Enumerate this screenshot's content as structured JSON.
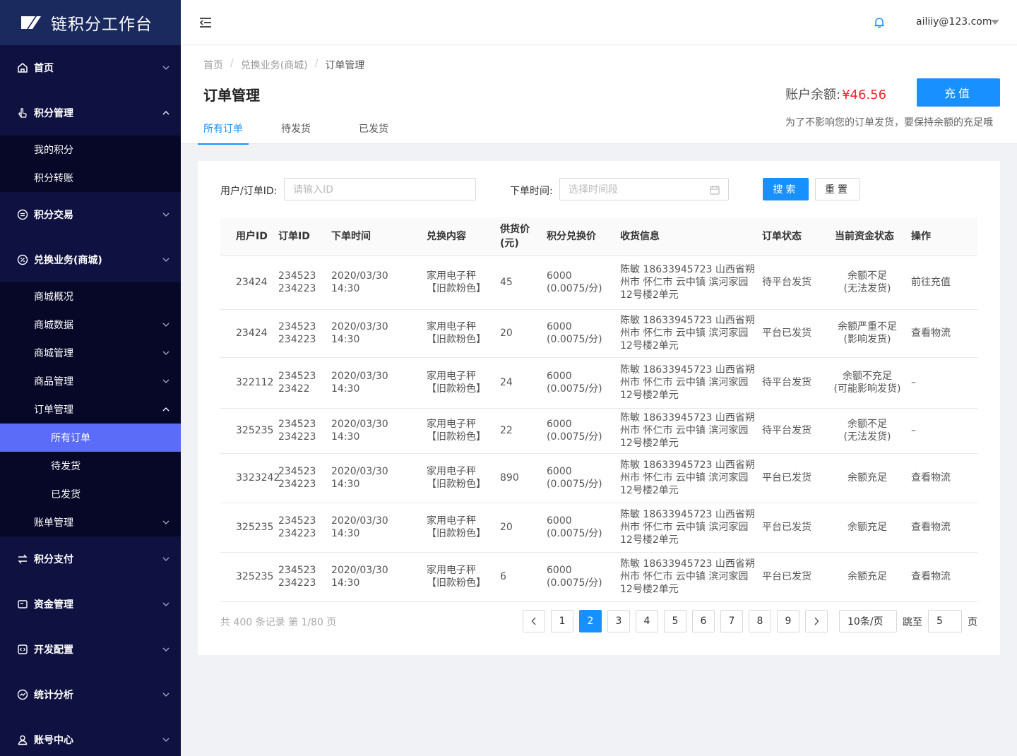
{
  "brand": {
    "name": "链积分工作台"
  },
  "sidebar": {
    "top": [
      {
        "label": "首页",
        "icon": "home-icon"
      },
      {
        "label": "积分管理",
        "icon": "hand-point-icon"
      },
      {
        "label": "积分交易",
        "icon": "exchange-circle-icon"
      },
      {
        "label": "兑换业务(商城)",
        "icon": "percent-circle-icon"
      },
      {
        "label": "积分支付",
        "icon": "transfer-icon"
      },
      {
        "label": "资金管理",
        "icon": "wallet-icon"
      },
      {
        "label": "开发配置",
        "icon": "code-icon"
      },
      {
        "label": "统计分析",
        "icon": "trend-icon"
      },
      {
        "label": "账号中心",
        "icon": "user-icon"
      }
    ],
    "points_sub": [
      "我的积分",
      "积分转账"
    ],
    "mall_sub": [
      "商城概况",
      "商城数据",
      "商城管理",
      "商品管理",
      "订单管理",
      "账单管理"
    ],
    "order_sub": [
      "所有订单",
      "待发货",
      "已发货"
    ]
  },
  "header": {
    "user_email": "ailiiy@123.com"
  },
  "breadcrumb": [
    "首页",
    "兑换业务(商城)",
    "订单管理"
  ],
  "page": {
    "title": "订单管理",
    "balance_label": "账户余额:",
    "balance_value": "¥46.56",
    "recharge_label": "充值",
    "hint": "为了不影响您的订单发货，要保持余额的充足哦"
  },
  "tabs": [
    "所有订单",
    "待发货",
    "已发货"
  ],
  "filters": {
    "id_label": "用户/订单ID:",
    "id_placeholder": "请输入ID",
    "time_label": "下单时间:",
    "time_placeholder": "选择时间段",
    "search_label": "搜索",
    "reset_label": "重置"
  },
  "table": {
    "headers": [
      "用户ID",
      "订单ID",
      "下单时间",
      "兑换内容",
      "供货价(元)",
      "积分兑换价",
      "收货信息",
      "订单状态",
      "当前资金状态",
      "操作"
    ],
    "rows": [
      {
        "user_id": "23424",
        "order_id_1": "234523",
        "order_id_2": "234223",
        "time": "2020/03/30 14:30",
        "item_1": "家用电子秤",
        "item_2": "【旧款粉色】",
        "supply": "45",
        "points_1": "6000",
        "points_2": "(0.0075/分)",
        "addr": "陈敏 18633945723 山西省朔州市 怀仁市 云中镇 滨河家园12号楼2单元",
        "status": "待平台发货",
        "status_color": "red",
        "fund_1": "余额不足",
        "fund_2": "(无法发货)",
        "fund_color": "red",
        "op": "前往充值",
        "op_link": true
      },
      {
        "user_id": "23424",
        "order_id_1": "234523",
        "order_id_2": "234223",
        "time": "2020/03/30 14:30",
        "item_1": "家用电子秤",
        "item_2": "【旧款粉色】",
        "supply": "20",
        "points_1": "6000",
        "points_2": "(0.0075/分)",
        "addr": "陈敏 18633945723 山西省朔州市 怀仁市 云中镇 滨河家园12号楼2单元",
        "status": "平台已发货",
        "status_color": "normal",
        "fund_1": "余额严重不足",
        "fund_2": "(影响发货)",
        "fund_color": "orange",
        "op": "查看物流",
        "op_link": true
      },
      {
        "user_id": "322112",
        "order_id_1": "234523",
        "order_id_2": "23422",
        "time": "2020/03/30 14:30",
        "item_1": "家用电子秤",
        "item_2": "【旧款粉色】",
        "supply": "24",
        "points_1": "6000",
        "points_2": "(0.0075/分)",
        "addr": "陈敏 18633945723 山西省朔州市 怀仁市 云中镇 滨河家园12号楼2单元",
        "status": "待平台发货",
        "status_color": "red",
        "fund_1": "余额不充足",
        "fund_2": "(可能影响发货)",
        "fund_color": "magenta",
        "op": "–",
        "op_link": false
      },
      {
        "user_id": "325235",
        "order_id_1": "234523",
        "order_id_2": "234223",
        "time": "2020/03/30 14:30",
        "item_1": "家用电子秤",
        "item_2": "【旧款粉色】",
        "supply": "22",
        "points_1": "6000",
        "points_2": "(0.0075/分)",
        "addr": "陈敏 18633945723 山西省朔州市 怀仁市 云中镇 滨河家园12号楼2单元",
        "status": "待平台发货",
        "status_color": "red",
        "fund_1": "余额不足",
        "fund_2": "(无法发货)",
        "fund_color": "red",
        "op": "–",
        "op_link": false
      },
      {
        "user_id": "3323242",
        "order_id_1": "234523",
        "order_id_2": "234223",
        "time": "2020/03/30 14:30",
        "item_1": "家用电子秤",
        "item_2": "【旧款粉色】",
        "supply": "890",
        "points_1": "6000",
        "points_2": "(0.0075/分)",
        "addr": "陈敏 18633945723 山西省朔州市 怀仁市 云中镇 滨河家园12号楼2单元",
        "status": "平台已发货",
        "status_color": "normal",
        "fund_1": "余额充足",
        "fund_2": "",
        "fund_color": "green",
        "op": "查看物流",
        "op_link": true
      },
      {
        "user_id": "325235",
        "order_id_1": "234523",
        "order_id_2": "234223",
        "time": "2020/03/30 14:30",
        "item_1": "家用电子秤",
        "item_2": "【旧款粉色】",
        "supply": "20",
        "points_1": "6000",
        "points_2": "(0.0075/分)",
        "addr": "陈敏 18633945723 山西省朔州市 怀仁市 云中镇 滨河家园12号楼2单元",
        "status": "平台已发货",
        "status_color": "normal",
        "fund_1": "余额充足",
        "fund_2": "",
        "fund_color": "green",
        "op": "查看物流",
        "op_link": true
      },
      {
        "user_id": "325235",
        "order_id_1": "234523",
        "order_id_2": "234223",
        "time": "2020/03/30 14:30",
        "item_1": "家用电子秤",
        "item_2": "【旧款粉色】",
        "supply": "6",
        "points_1": "6000",
        "points_2": "(0.0075/分)",
        "addr": "陈敏 18633945723 山西省朔州市 怀仁市 云中镇 滨河家园12号楼2单元",
        "status": "平台已发货",
        "status_color": "normal",
        "fund_1": "余额充足",
        "fund_2": "",
        "fund_color": "green",
        "op": "查看物流",
        "op_link": true
      }
    ]
  },
  "pagination": {
    "total_text": "共 400 条记录 第 1/80 页",
    "pages": [
      "1",
      "2",
      "3",
      "4",
      "5",
      "6",
      "7",
      "8",
      "9"
    ],
    "current": "2",
    "page_size": "10条/页",
    "jump_label": "跳至",
    "jump_value": "5",
    "page_suffix": "页"
  }
}
